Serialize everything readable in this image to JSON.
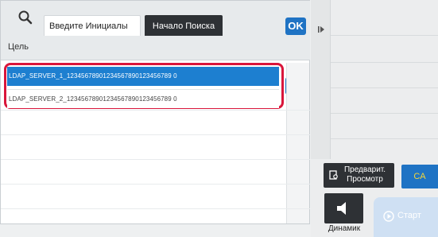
{
  "search": {
    "placeholder": "Введите Инициалы",
    "start_button_label": "Начало Поиска",
    "ok_label": "OK"
  },
  "target": {
    "label": "Цель",
    "ok_label": "OK"
  },
  "list": {
    "items": [
      {
        "label": "LDAP_SERVER_1_12345678901234567890123456789 0",
        "selected": true
      },
      {
        "label": "LDAP_SERVER_2_12345678901234567890123456789 0",
        "selected": false
      }
    ]
  },
  "right_panel": {
    "preview_label": "Предварит. Просмотр",
    "ca_label": "CA",
    "speaker_label": "Динамик",
    "start_label": "Старт"
  },
  "colors": {
    "accent_blue": "#1f73c4",
    "selected_row": "#1d7fd0",
    "highlight_red": "#d9163b",
    "ca_text": "#f4d63a",
    "dark_button": "#2e3135"
  },
  "icons": [
    "search-icon",
    "expand-arrow-icon",
    "preview-icon",
    "speaker-icon",
    "start-icon"
  ]
}
